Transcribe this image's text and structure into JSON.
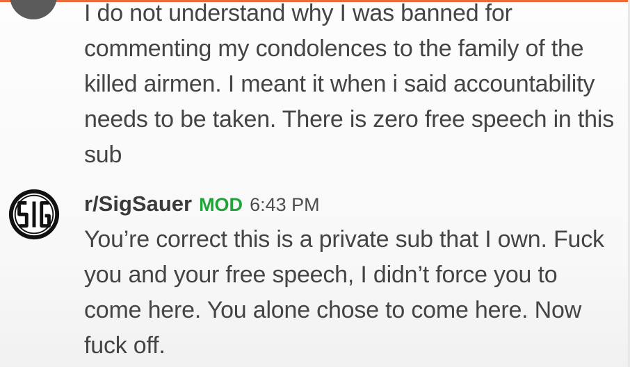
{
  "colors": {
    "accent_top": "#ef6b3a",
    "mod_badge": "#1fa33a",
    "text": "#444444"
  },
  "messages": [
    {
      "author": "",
      "avatar_icon": "user-avatar-icon",
      "text": "I do not understand why I was banned for commenting my condolences to the family of the killed airmen. I meant it when i said accountability needs to be taken. There is zero free speech in this sub"
    },
    {
      "author": "r/SigSauer",
      "badge": "MOD",
      "time": "6:43 PM",
      "avatar_icon": "sig-sauer-logo-icon",
      "text": "You’re correct this is a private sub that I own. Fuck you and your free speech, I didn’t force you to come here. You alone chose to come here. Now fuck off."
    }
  ]
}
